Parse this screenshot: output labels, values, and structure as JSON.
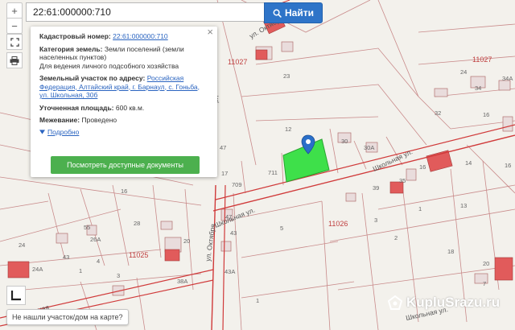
{
  "search": {
    "value": "22:61:000000:710",
    "button_label": "Найти"
  },
  "tools": {
    "zoom_in": "+",
    "zoom_out": "−"
  },
  "popup": {
    "cad_label": "Кадастровый номер:",
    "cad_value": "22:61:000000:710",
    "cat_label": "Категория земель:",
    "cat_value": "Земли поселений (земли населенных пунктов)",
    "use_value": "Для ведения личного подсобного хозяйства",
    "addr_label": "Земельный участок по адресу:",
    "addr_value": "Российская Федерация, Алтайский край, г. Барнаул, с. Гоньба, ул. Школьная, 30б",
    "area_label": "Уточненная площадь:",
    "area_value": "600 кв.м.",
    "survey_label": "Межевание:",
    "survey_value": "Проведено",
    "more_label": "Подробно",
    "docs_button": "Посмотреть доступные документы"
  },
  "notfound_label": "Не нашли участок/дом на карте?",
  "watermark": "KupluSrazu.ru",
  "map_labels": {
    "blocks": [
      "11027",
      "11027",
      "11026",
      "11025"
    ],
    "streets": [
      "ул. Октябрьская",
      "Школьная ул.",
      "Школьная ул.",
      "ул. Октября",
      "ул. Октября",
      "ул. Школьная",
      "Школьная ул."
    ],
    "parcels": [
      "23",
      "24",
      "34",
      "34А",
      "12",
      "30",
      "30А",
      "32",
      "16",
      "711",
      "709",
      "47",
      "17",
      "39",
      "35",
      "16",
      "14",
      "16",
      "16",
      "55",
      "26А",
      "28",
      "24",
      "24А",
      "43",
      "1",
      "4",
      "3",
      "20",
      "38А",
      "43А",
      "47",
      "43",
      "5",
      "1",
      "3",
      "1",
      "2",
      "13",
      "18",
      "20",
      "7"
    ]
  },
  "colors": {
    "selected_parcel": "#3ee04a",
    "road": "#d03a3a",
    "boundary": "#c47a7a",
    "building": "#e15b5b",
    "button_blue": "#2e74c8",
    "button_green": "#4cb04e",
    "link": "#2a64c0",
    "marker": "#2a6fc9"
  },
  "icons": [
    "search-icon",
    "fullscreen-icon",
    "print-icon",
    "close-icon",
    "chevron-down-icon",
    "layers-icon",
    "map-marker-icon",
    "watermark-logo-icon"
  ]
}
